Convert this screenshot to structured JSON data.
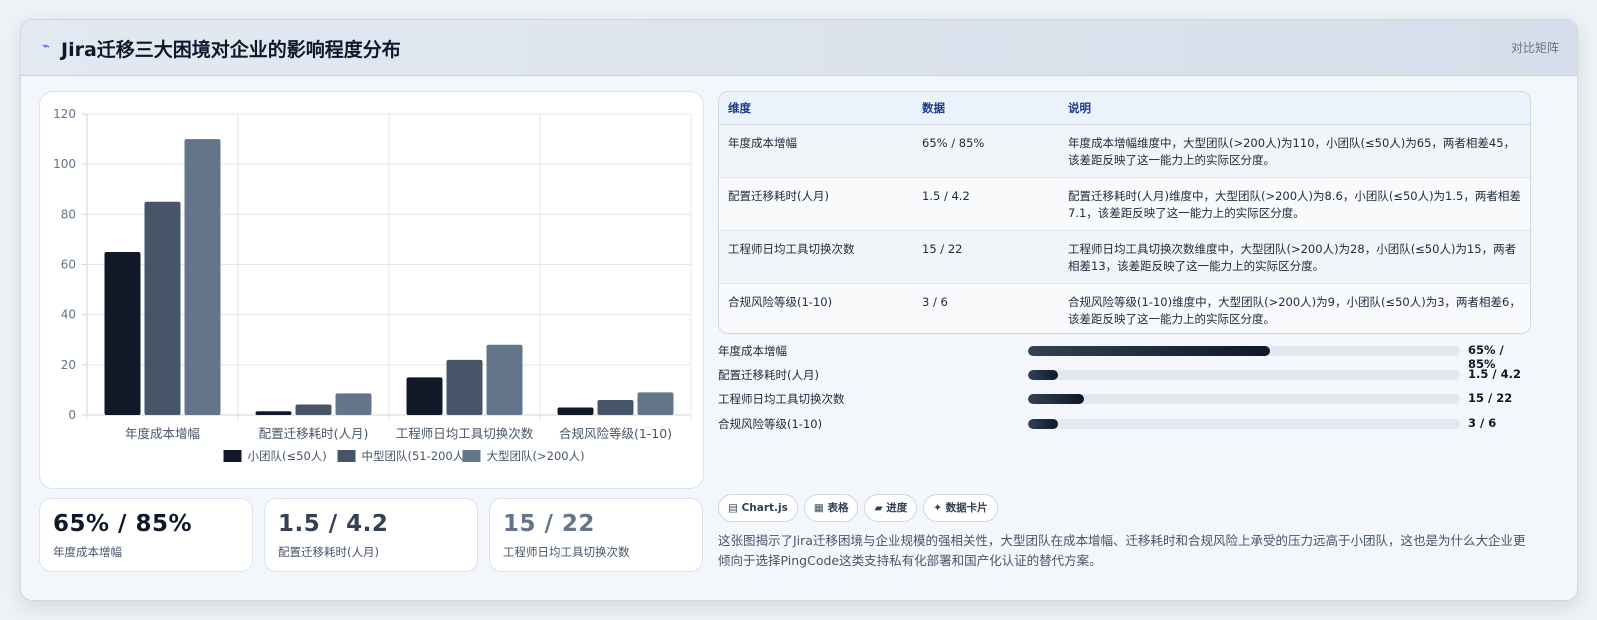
{
  "header": {
    "icon": "lightning-icon",
    "title": "Jira迁移三大困境对企业的影响程度分布",
    "action_label": "对比矩阵"
  },
  "chart_data": {
    "type": "bar",
    "categories": [
      "年度成本增幅",
      "配置迁移耗时(人月)",
      "工程师日均工具切换次数",
      "合规风险等级(1-10)"
    ],
    "series": [
      {
        "name": "小团队(≤50人)",
        "values": [
          65,
          1.5,
          15,
          3
        ],
        "color": "#111827"
      },
      {
        "name": "中型团队(51-200人)",
        "values": [
          85,
          4.2,
          22,
          6
        ],
        "color": "#475569"
      },
      {
        "name": "大型团队(>200人)",
        "values": [
          110,
          8.6,
          28,
          9
        ],
        "color": "#64748b"
      }
    ],
    "ylim": [
      0,
      120
    ],
    "yticks": [
      0,
      20,
      40,
      60,
      80,
      100,
      120
    ],
    "grid": true,
    "legend": "bottom-center"
  },
  "stats": [
    {
      "value": "65% / 85%",
      "label": "年度成本增幅",
      "color": "#0f172a"
    },
    {
      "value": "1.5 / 4.2",
      "label": "配置迁移耗时(人月)",
      "color": "#334155"
    },
    {
      "value": "15 / 22",
      "label": "工程师日均工具切换次数",
      "color": "#64748b"
    }
  ],
  "table": {
    "headers": [
      "维度",
      "数据",
      "说明"
    ],
    "rows": [
      [
        "年度成本增幅",
        "65% / 85%",
        "年度成本增幅维度中，大型团队(>200人)为110，小团队(≤50人)为65，两者相差45，该差距反映了这一能力上的实际区分度。"
      ],
      [
        "配置迁移耗时(人月)",
        "1.5 / 4.2",
        "配置迁移耗时(人月)维度中，大型团队(>200人)为8.6，小团队(≤50人)为1.5，两者相差7.1，该差距反映了这一能力上的实际区分度。"
      ],
      [
        "工程师日均工具切换次数",
        "15 / 22",
        "工程师日均工具切换次数维度中，大型团队(>200人)为28，小团队(≤50人)为15，两者相差13，该差距反映了这一能力上的实际区分度。"
      ],
      [
        "合规风险等级(1-10)",
        "3 / 6",
        "合规风险等级(1-10)维度中，大型团队(>200人)为9，小团队(≤50人)为3，两者相差6，该差距反映了这一能力上的实际区分度。"
      ]
    ]
  },
  "progress": [
    {
      "label": "年度成本增幅",
      "value": "65% / 85%",
      "fraction": 0.56
    },
    {
      "label": "配置迁移耗时(人月)",
      "value": "1.5 / 4.2",
      "fraction": 0.07
    },
    {
      "label": "工程师日均工具切换次数",
      "value": "15 / 22",
      "fraction": 0.13
    },
    {
      "label": "合规风险等级(1-10)",
      "value": "3 / 6",
      "fraction": 0.07
    }
  ],
  "chips": [
    {
      "icon": "chart-icon",
      "glyph": "▤",
      "label": "Chart.js"
    },
    {
      "icon": "table-icon",
      "glyph": "▦",
      "label": "表格"
    },
    {
      "icon": "progress-icon",
      "glyph": "▰",
      "label": "进度"
    },
    {
      "icon": "sparkle-icon",
      "glyph": "✦",
      "label": "数据卡片"
    }
  ],
  "summary": "这张图揭示了Jira迁移困境与企业规模的强相关性，大型团队在成本增幅、迁移耗时和合规风险上承受的压力远高于小团队，这也是为什么大企业更倾向于选择PingCode这类支持私有化部署和国产化认证的替代方案。"
}
